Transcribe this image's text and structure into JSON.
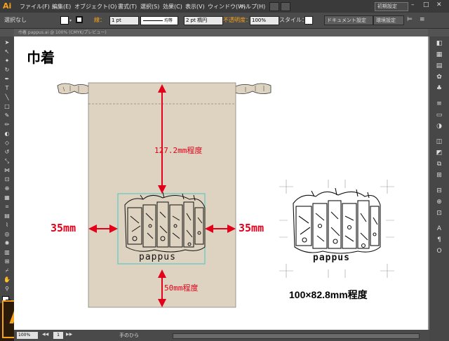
{
  "app": {
    "logo": "Ai"
  },
  "menu": {
    "items": [
      "ファイル(F)",
      "編集(E)",
      "オブジェクト(O)",
      "書式(T)",
      "選択(S)",
      "効果(C)",
      "表示(V)",
      "ウィンドウ(W)",
      "ヘルプ(H)"
    ],
    "workspace": "初期設定"
  },
  "control": {
    "selection": "選択なし",
    "stroke_label": "線：",
    "stroke_weight": "1 pt",
    "stroke_profile": "均等",
    "brush": "2 pt 楕円",
    "opacity_label": "不透明度：",
    "opacity_value": "100%",
    "style_label": "スタイル：",
    "doc_setup": "ドキュメント設定",
    "prefs": "環境設定"
  },
  "document": {
    "tab": "巾着 pappus.ai @ 100% (CMYK/プレビュー)"
  },
  "artboard": {
    "title": "巾着",
    "dim_top": "127.2mm程度",
    "dim_bottom": "50mm程度",
    "dim_left": "35mm",
    "dim_right": "35mm",
    "logo_text": "pappus",
    "preview_logo_text": "pappus",
    "preview_size": "100×82.8mm程度"
  },
  "status": {
    "zoom": "100%",
    "page": "1",
    "tool": "手のひら"
  },
  "colors": {
    "accent_red": "#e3001b",
    "bag_fill": "#ddd3c0",
    "ai_orange": "#f7a21b",
    "frame_cyan": "#46c6c6"
  }
}
